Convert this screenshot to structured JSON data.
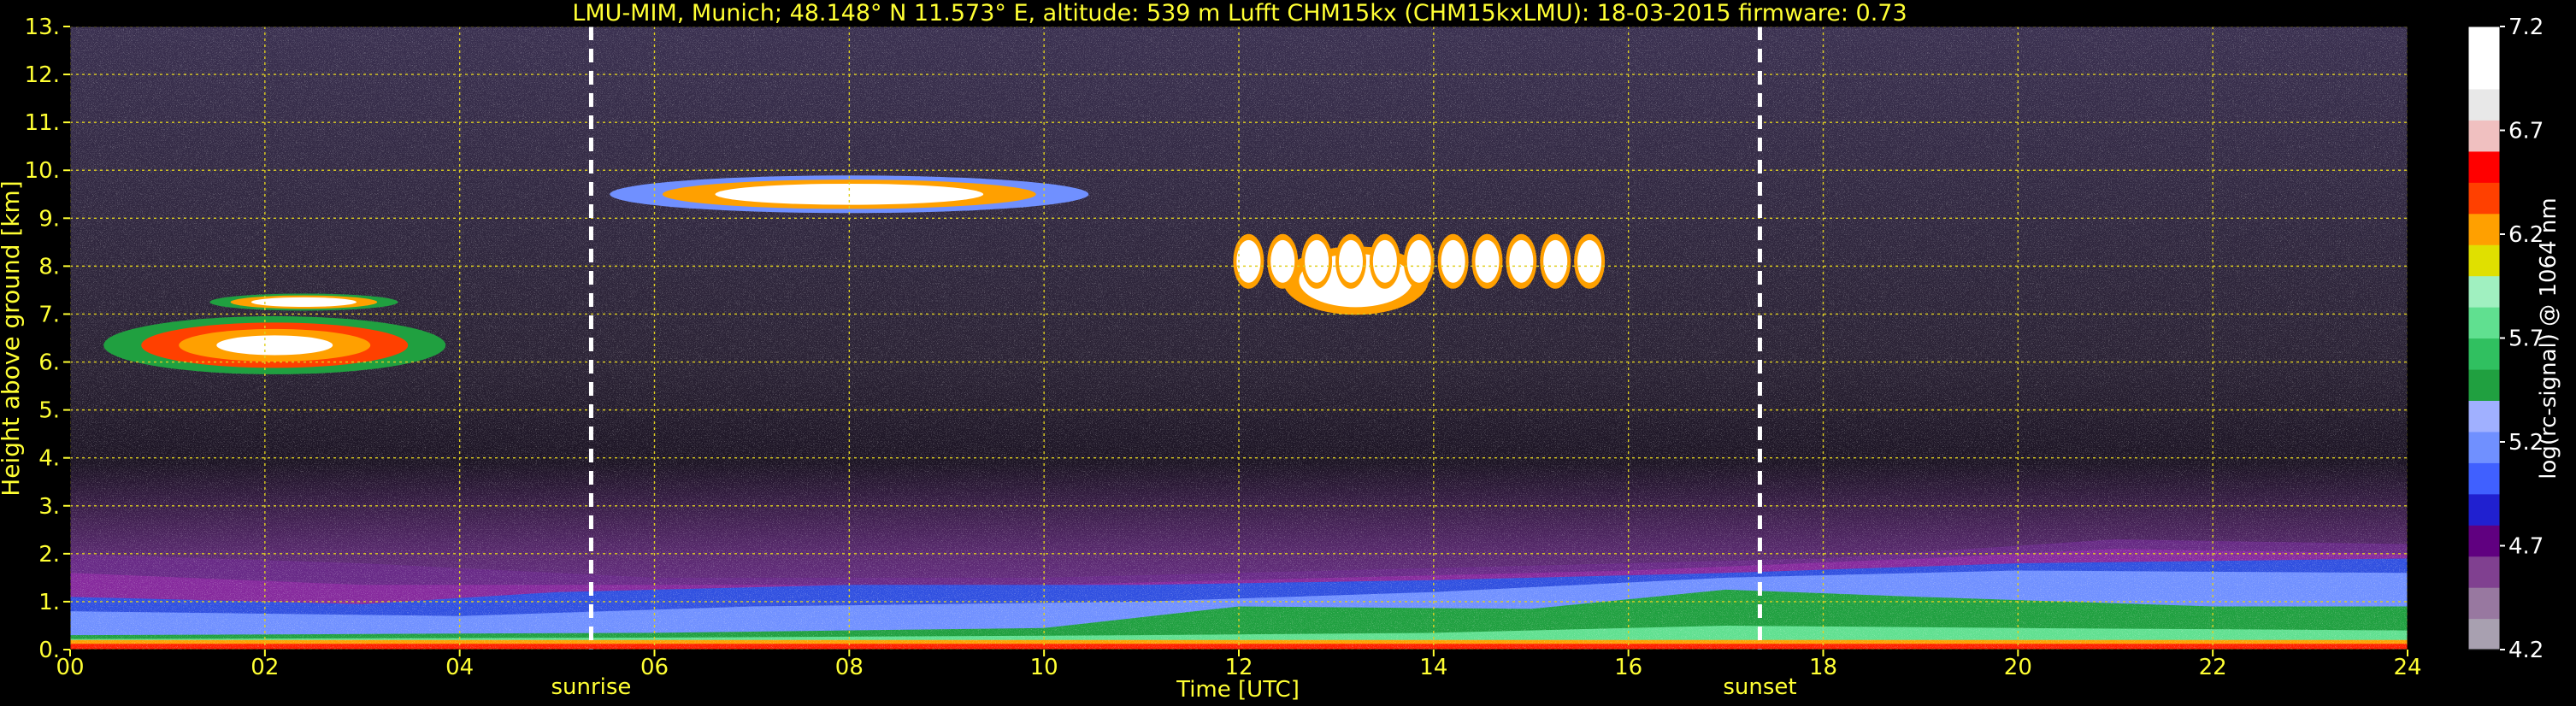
{
  "chart_data": {
    "type": "heatmap",
    "title": "LMU-MIM, Munich; 48.148° N 11.573° E, altitude: 539 m    Lufft CHM15kx (CHM15kxLMU): 18-03-2015    firmware: 0.73",
    "xlabel": "Time [UTC]",
    "ylabel": "Height above ground [km]",
    "x_ticks": [
      "00",
      "02",
      "04",
      "06",
      "08",
      "10",
      "12",
      "14",
      "16",
      "18",
      "20",
      "22",
      "24"
    ],
    "y_ticks": [
      "0.",
      "1.",
      "2.",
      "3.",
      "4.",
      "5.",
      "6.",
      "7.",
      "8.",
      "9.",
      "10.",
      "11.",
      "12.",
      "13."
    ],
    "xlim": [
      0,
      24
    ],
    "ylim": [
      0,
      13
    ],
    "grid": true,
    "events": [
      {
        "label": "sunrise",
        "time": 5.35
      },
      {
        "label": "sunset",
        "time": 17.35
      }
    ],
    "colorbar": {
      "label": "log(rc-signal) @ 1064 nm",
      "ticks": [
        "4.2",
        "4.7",
        "5.2",
        "5.7",
        "6.2",
        "6.7",
        "7.2"
      ],
      "range": [
        4.2,
        7.2
      ],
      "colors": [
        "#a8a0b0",
        "#9878a0",
        "#804090",
        "#600080",
        "#2020d0",
        "#4060ff",
        "#7090ff",
        "#a0b0ff",
        "#20a040",
        "#30c060",
        "#60e090",
        "#a0f0c0",
        "#e0e000",
        "#ffa000",
        "#ff4000",
        "#ff0000",
        "#f0c0c0",
        "#e8e8e8",
        "#ffffff",
        "#ffffff"
      ]
    },
    "features": [
      {
        "name": "boundary-layer",
        "description": "strong backscatter below ~1.5 km all day"
      },
      {
        "name": "cirrus-cloud",
        "time_range": [
          0.6,
          3.2
        ],
        "height_range": [
          5.9,
          7.4
        ]
      },
      {
        "name": "cirrus-cloud",
        "time_range": [
          6.8,
          9.2
        ],
        "height_range": [
          8.9,
          9.9
        ]
      },
      {
        "name": "cirrus-cloud",
        "time_range": [
          11.9,
          15.8
        ],
        "height_range": [
          7.0,
          8.7
        ]
      }
    ]
  }
}
